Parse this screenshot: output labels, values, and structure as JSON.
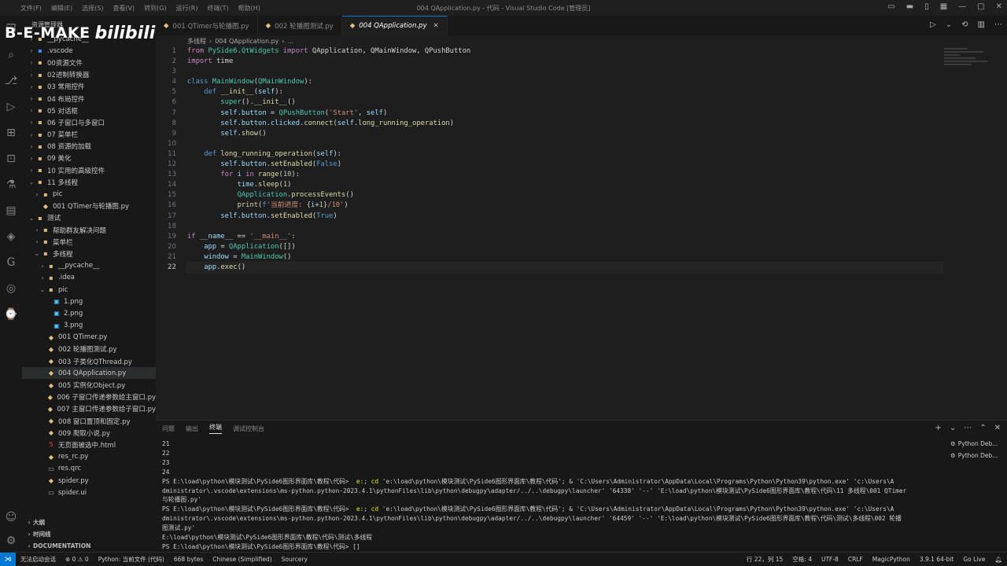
{
  "titlebar": {
    "menu": [
      "文件(F)",
      "编辑(E)",
      "选择(S)",
      "查看(V)",
      "转到(G)",
      "运行(R)",
      "终端(T)",
      "帮助(H)"
    ],
    "title": "004 QApplication.py - 代码 - Visual Studio Code [管理员]"
  },
  "watermark": {
    "text1": "B-E-MAKE",
    "text2": "bilibili"
  },
  "sidebar": {
    "header": "资源管理器",
    "items": [
      {
        "label": "__pycache__",
        "depth": 1,
        "chev": "›",
        "icon": "▪",
        "iconColor": "#d7ba7d"
      },
      {
        "label": ".vscode",
        "depth": 1,
        "chev": "›",
        "icon": "▪",
        "iconColor": "#3794ff"
      },
      {
        "label": "00资源文件",
        "depth": 1,
        "chev": "›",
        "icon": "▪",
        "iconColor": "#d7ba7d"
      },
      {
        "label": "02进制转换器",
        "depth": 1,
        "chev": "›",
        "icon": "▪",
        "iconColor": "#d7ba7d"
      },
      {
        "label": "03 常用控件",
        "depth": 1,
        "chev": "›",
        "icon": "▪",
        "iconColor": "#d7ba7d"
      },
      {
        "label": "04 布局控件",
        "depth": 1,
        "chev": "›",
        "icon": "▪",
        "iconColor": "#d7ba7d"
      },
      {
        "label": "05 对话框",
        "depth": 1,
        "chev": "›",
        "icon": "▪",
        "iconColor": "#d7ba7d"
      },
      {
        "label": "06 子窗口与多窗口",
        "depth": 1,
        "chev": "›",
        "icon": "▪",
        "iconColor": "#d7ba7d"
      },
      {
        "label": "07 菜单栏",
        "depth": 1,
        "chev": "›",
        "icon": "▪",
        "iconColor": "#d7ba7d"
      },
      {
        "label": "08 资源的加载",
        "depth": 1,
        "chev": "›",
        "icon": "▪",
        "iconColor": "#d7ba7d"
      },
      {
        "label": "09 美化",
        "depth": 1,
        "chev": "›",
        "icon": "▪",
        "iconColor": "#d7ba7d"
      },
      {
        "label": "10 实用的高级控件",
        "depth": 1,
        "chev": "›",
        "icon": "▪",
        "iconColor": "#d7ba7d"
      },
      {
        "label": "11 多线程",
        "depth": 1,
        "chev": "⌄",
        "icon": "▪",
        "iconColor": "#d7ba7d"
      },
      {
        "label": "pic",
        "depth": 2,
        "chev": "›",
        "icon": "▪",
        "iconColor": "#d7ba7d"
      },
      {
        "label": "001 QTimer与轮播图.py",
        "depth": 2,
        "chev": "",
        "icon": "◆",
        "iconColor": "#e5c07b"
      },
      {
        "label": "测试",
        "depth": 1,
        "chev": "⌄",
        "icon": "▪",
        "iconColor": "#d7ba7d"
      },
      {
        "label": "帮助群友解决问题",
        "depth": 2,
        "chev": "›",
        "icon": "▪",
        "iconColor": "#d7ba7d"
      },
      {
        "label": "菜单栏",
        "depth": 2,
        "chev": "›",
        "icon": "▪",
        "iconColor": "#d7ba7d"
      },
      {
        "label": "多线程",
        "depth": 2,
        "chev": "⌄",
        "icon": "▪",
        "iconColor": "#d7ba7d"
      },
      {
        "label": "__pycache__",
        "depth": 3,
        "chev": "›",
        "icon": "▪",
        "iconColor": "#d7ba7d"
      },
      {
        "label": ".idea",
        "depth": 3,
        "chev": "›",
        "icon": "▪",
        "iconColor": "#d7ba7d"
      },
      {
        "label": "pic",
        "depth": 3,
        "chev": "⌄",
        "icon": "▪",
        "iconColor": "#d7ba7d"
      },
      {
        "label": "1.png",
        "depth": 4,
        "chev": "",
        "icon": "▣",
        "iconColor": "#4fc1ff"
      },
      {
        "label": "2.png",
        "depth": 4,
        "chev": "",
        "icon": "▣",
        "iconColor": "#4fc1ff"
      },
      {
        "label": "3.png",
        "depth": 4,
        "chev": "",
        "icon": "▣",
        "iconColor": "#4fc1ff"
      },
      {
        "label": "001 QTimer.py",
        "depth": 3,
        "chev": "",
        "icon": "◆",
        "iconColor": "#e5c07b"
      },
      {
        "label": "002 轮播图测试.py",
        "depth": 3,
        "chev": "",
        "icon": "◆",
        "iconColor": "#e5c07b"
      },
      {
        "label": "003 子类化QThread.py",
        "depth": 3,
        "chev": "",
        "icon": "◆",
        "iconColor": "#e5c07b"
      },
      {
        "label": "004 QApplication.py",
        "depth": 3,
        "chev": "",
        "icon": "◆",
        "iconColor": "#e5c07b",
        "selected": true
      },
      {
        "label": "005 实例化Object.py",
        "depth": 3,
        "chev": "",
        "icon": "◆",
        "iconColor": "#e5c07b"
      },
      {
        "label": "006 子窗口传递参数给主窗口.py",
        "depth": 3,
        "chev": "",
        "icon": "◆",
        "iconColor": "#e5c07b"
      },
      {
        "label": "007 主窗口传递参数给子窗口.py",
        "depth": 3,
        "chev": "",
        "icon": "◆",
        "iconColor": "#e5c07b"
      },
      {
        "label": "008 窗口置顶和固定.py",
        "depth": 3,
        "chev": "",
        "icon": "◆",
        "iconColor": "#e5c07b"
      },
      {
        "label": "009 爬取小说.py",
        "depth": 3,
        "chev": "",
        "icon": "◆",
        "iconColor": "#e5c07b"
      },
      {
        "label": "无页面被选中.html",
        "depth": 3,
        "chev": "",
        "icon": "5",
        "iconColor": "#e44d26"
      },
      {
        "label": "res_rc.py",
        "depth": 3,
        "chev": "",
        "icon": "◆",
        "iconColor": "#e5c07b"
      },
      {
        "label": "res.qrc",
        "depth": 3,
        "chev": "",
        "icon": "▭",
        "iconColor": "#aaaaaa"
      },
      {
        "label": "spider.py",
        "depth": 3,
        "chev": "",
        "icon": "◆",
        "iconColor": "#e5c07b"
      },
      {
        "label": "spider.ui",
        "depth": 3,
        "chev": "",
        "icon": "▭",
        "iconColor": "#aaaaaa"
      }
    ],
    "footer": [
      "大纲",
      "时间线",
      "DOCUMENTATION"
    ]
  },
  "tabs": [
    {
      "label": "001 QTimer与轮播图.py",
      "active": false
    },
    {
      "label": "002 轮播图测试.py",
      "active": false
    },
    {
      "label": "004 QApplication.py",
      "active": true
    }
  ],
  "breadcrumb": [
    "多线程",
    "004 QApplication.py",
    "..."
  ],
  "editor": {
    "currentLine": 22,
    "lines": [
      [
        [
          "kw",
          "from "
        ],
        [
          "cls",
          "PySide6"
        ],
        [
          "w",
          "."
        ],
        [
          "cls",
          "QtWidgets"
        ],
        [
          "kw",
          " import "
        ],
        [
          "w",
          "QApplication, QMainWindow, QPushButton"
        ]
      ],
      [
        [
          "kw",
          "import "
        ],
        [
          "w",
          "time"
        ]
      ],
      [],
      [
        [
          "kw2",
          "class "
        ],
        [
          "cls",
          "MainWindow"
        ],
        [
          "w",
          "("
        ],
        [
          "cls",
          "QMainWindow"
        ],
        [
          "w",
          "):"
        ]
      ],
      [
        [
          "w",
          "    "
        ],
        [
          "kw2",
          "def "
        ],
        [
          "fn",
          "__init__"
        ],
        [
          "w",
          "("
        ],
        [
          "var",
          "self"
        ],
        [
          "w",
          "):"
        ]
      ],
      [
        [
          "w",
          "        "
        ],
        [
          "cls",
          "super"
        ],
        [
          "w",
          "()."
        ],
        [
          "fn",
          "__init__"
        ],
        [
          "w",
          "()"
        ]
      ],
      [
        [
          "w",
          "        "
        ],
        [
          "var",
          "self"
        ],
        [
          "w",
          "."
        ],
        [
          "var",
          "button"
        ],
        [
          "w",
          " = "
        ],
        [
          "cls",
          "QPushButton"
        ],
        [
          "w",
          "("
        ],
        [
          "str",
          "'Start'"
        ],
        [
          "w",
          ", "
        ],
        [
          "var",
          "self"
        ],
        [
          "w",
          ")"
        ]
      ],
      [
        [
          "w",
          "        "
        ],
        [
          "var",
          "self"
        ],
        [
          "w",
          "."
        ],
        [
          "var",
          "button"
        ],
        [
          "w",
          "."
        ],
        [
          "var",
          "clicked"
        ],
        [
          "w",
          "."
        ],
        [
          "fn",
          "connect"
        ],
        [
          "w",
          "("
        ],
        [
          "var",
          "self"
        ],
        [
          "w",
          "."
        ],
        [
          "fn",
          "long_running_operation"
        ],
        [
          "w",
          ")"
        ]
      ],
      [
        [
          "w",
          "        "
        ],
        [
          "var",
          "self"
        ],
        [
          "w",
          "."
        ],
        [
          "fn",
          "show"
        ],
        [
          "w",
          "()"
        ]
      ],
      [],
      [
        [
          "w",
          "    "
        ],
        [
          "kw2",
          "def "
        ],
        [
          "fn",
          "long_running_operation"
        ],
        [
          "w",
          "("
        ],
        [
          "var",
          "self"
        ],
        [
          "w",
          "):"
        ]
      ],
      [
        [
          "w",
          "        "
        ],
        [
          "var",
          "self"
        ],
        [
          "w",
          "."
        ],
        [
          "var",
          "button"
        ],
        [
          "w",
          "."
        ],
        [
          "fn",
          "setEnabled"
        ],
        [
          "w",
          "("
        ],
        [
          "kw2",
          "False"
        ],
        [
          "w",
          ")"
        ]
      ],
      [
        [
          "w",
          "        "
        ],
        [
          "kw",
          "for "
        ],
        [
          "var",
          "i"
        ],
        [
          "kw",
          " in "
        ],
        [
          "fn",
          "range"
        ],
        [
          "w",
          "("
        ],
        [
          "num",
          "10"
        ],
        [
          "w",
          "):"
        ]
      ],
      [
        [
          "w",
          "            "
        ],
        [
          "var",
          "time"
        ],
        [
          "w",
          "."
        ],
        [
          "fn",
          "sleep"
        ],
        [
          "w",
          "("
        ],
        [
          "num",
          "1"
        ],
        [
          "w",
          ")"
        ]
      ],
      [
        [
          "w",
          "            "
        ],
        [
          "cls",
          "QApplication"
        ],
        [
          "w",
          "."
        ],
        [
          "fn",
          "processEvents"
        ],
        [
          "w",
          "()"
        ]
      ],
      [
        [
          "w",
          "            "
        ],
        [
          "fn",
          "print"
        ],
        [
          "w",
          "("
        ],
        [
          "kw2",
          "f"
        ],
        [
          "str",
          "'当前进度: "
        ],
        [
          "w",
          "{"
        ],
        [
          "var",
          "i"
        ],
        [
          "w",
          "+"
        ],
        [
          "num",
          "1"
        ],
        [
          "w",
          "}"
        ],
        [
          "str",
          "/10'"
        ],
        [
          "w",
          ")"
        ]
      ],
      [
        [
          "w",
          "        "
        ],
        [
          "var",
          "self"
        ],
        [
          "w",
          "."
        ],
        [
          "var",
          "button"
        ],
        [
          "w",
          "."
        ],
        [
          "fn",
          "setEnabled"
        ],
        [
          "w",
          "("
        ],
        [
          "kw2",
          "True"
        ],
        [
          "w",
          ")"
        ]
      ],
      [],
      [
        [
          "kw",
          "if "
        ],
        [
          "var",
          "__name__"
        ],
        [
          "w",
          " == "
        ],
        [
          "str",
          "'__main__'"
        ],
        [
          "w",
          ":"
        ]
      ],
      [
        [
          "w",
          "    "
        ],
        [
          "var",
          "app"
        ],
        [
          "w",
          " = "
        ],
        [
          "cls",
          "QApplication"
        ],
        [
          "w",
          "([])"
        ]
      ],
      [
        [
          "w",
          "    "
        ],
        [
          "var",
          "window"
        ],
        [
          "w",
          " = "
        ],
        [
          "cls",
          "MainWindow"
        ],
        [
          "w",
          "()"
        ]
      ],
      [
        [
          "w",
          "    "
        ],
        [
          "var",
          "app"
        ],
        [
          "w",
          "."
        ],
        [
          "fn",
          "exec"
        ],
        [
          "w",
          "()"
        ]
      ]
    ]
  },
  "panel": {
    "tabs": [
      "问题",
      "输出",
      "终端",
      "调试控制台"
    ],
    "activeTab": "终端",
    "terminal": [
      [
        [
          "w",
          "21"
        ]
      ],
      [
        [
          "w",
          "22"
        ]
      ],
      [
        [
          "w",
          "23"
        ]
      ],
      [
        [
          "w",
          "24"
        ]
      ],
      [
        [
          "w",
          "PS E:\\load\\python\\模块测试\\PySide6图形界面库\\教程\\代码>  "
        ],
        [
          "y",
          "e:"
        ],
        [
          "w",
          "; "
        ],
        [
          "y",
          "cd"
        ],
        [
          "w",
          " 'e:\\load\\python\\模块测试\\PySide6图形界面库\\教程\\代码'; & 'C:\\Users\\Administrator\\AppData\\Local\\Programs\\Python\\Python39\\python.exe' 'c:\\Users\\A"
        ]
      ],
      [
        [
          "w",
          "dministrator\\.vscode\\extensions\\ms-python.python-2023.4.1\\pythonFiles\\lib\\python\\debugpy\\adapter/../..\\debugpy\\launcher' '64338' '--' 'E:\\load\\python\\模块测试\\PySide6图形界面库\\教程\\代码\\11 多线程\\001 QTimer"
        ]
      ],
      [
        [
          "w",
          "与轮播图.py'"
        ]
      ],
      [
        [
          "w",
          "PS E:\\load\\python\\模块测试\\PySide6图形界面库\\教程\\代码>  "
        ],
        [
          "y",
          "e:"
        ],
        [
          "w",
          "; "
        ],
        [
          "y",
          "cd"
        ],
        [
          "w",
          " 'e:\\load\\python\\模块测试\\PySide6图形界面库\\教程\\代码'; & 'C:\\Users\\Administrator\\AppData\\Local\\Programs\\Python\\Python39\\python.exe' 'c:\\Users\\A"
        ]
      ],
      [
        [
          "w",
          "dministrator\\.vscode\\extensions\\ms-python.python-2023.4.1\\pythonFiles\\lib\\python\\debugpy\\adapter/../..\\debugpy\\launcher' '64459' '--' 'E:\\load\\python\\模块测试\\PySide6图形界面库\\教程\\代码\\测试\\多线程\\002 轮播"
        ]
      ],
      [
        [
          "w",
          "图测试.py'"
        ]
      ],
      [
        [
          "w",
          "E:\\load\\python\\模块测试\\PySide6图形界面库\\教程\\代码\\测试\\多线程"
        ]
      ],
      [
        [
          "w",
          "PS E:\\load\\python\\模块测试\\PySide6图形界面库\\教程\\代码> []"
        ]
      ]
    ],
    "terminals": [
      "Python Deb...",
      "Python Deb..."
    ]
  },
  "statusbar": {
    "left": [
      "无法启动会话",
      "⊗ 0 ⚠ 0",
      "Python: 当前文件 (代码)",
      "668 bytes",
      "Chinese (Simplified)",
      "Sourcery"
    ],
    "right": [
      "行 22，列 15",
      "空格: 4",
      "UTF-8",
      "CRLF",
      "MagicPython",
      "3.9.1 64-bit",
      "Go Live"
    ]
  },
  "colors": {
    "accent": "#0078d4",
    "editorBg": "#1e1e1e",
    "sidebarBg": "#181818"
  }
}
